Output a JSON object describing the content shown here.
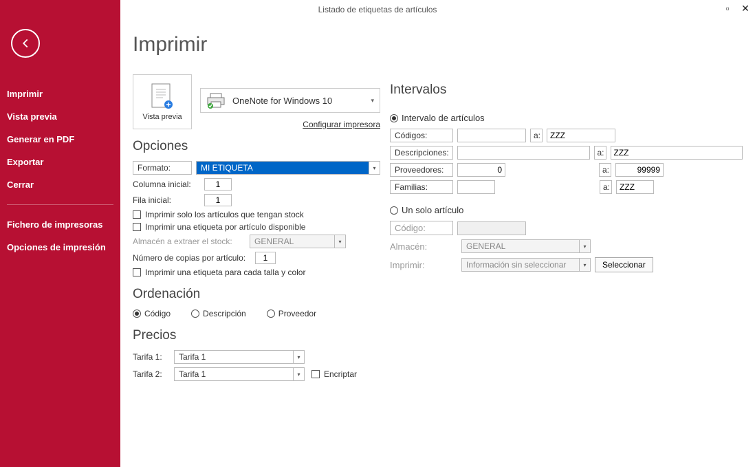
{
  "window": {
    "title": "Listado de etiquetas de artículos"
  },
  "sidebar": {
    "items": [
      "Imprimir",
      "Vista previa",
      "Generar en PDF",
      "Exportar",
      "Cerrar"
    ],
    "items2": [
      "Fichero de impresoras",
      "Opciones de impresión"
    ]
  },
  "page": {
    "title": "Imprimir"
  },
  "printtop": {
    "preview_label": "Vista previa",
    "printer_name": "OneNote for Windows 10",
    "config_link": "Configurar impresora"
  },
  "opciones": {
    "title": "Opciones",
    "formato_lbl": "Formato:",
    "formato_val": "MI ETIQUETA",
    "col_inicial_lbl": "Columna inicial:",
    "col_inicial_val": "1",
    "fila_inicial_lbl": "Fila inicial:",
    "fila_inicial_val": "1",
    "cb_stock": "Imprimir solo los artículos que tengan stock",
    "cb_disponible": "Imprimir una etiqueta por artículo disponible",
    "almacen_lbl": "Almacén a extraer el stock:",
    "almacen_val": "GENERAL",
    "copias_lbl": "Número de copias por artículo:",
    "copias_val": "1",
    "cb_tallacolor": "Imprimir una etiqueta para cada talla y color"
  },
  "orden": {
    "title": "Ordenación",
    "o1": "Código",
    "o2": "Descripción",
    "o3": "Proveedor"
  },
  "precios": {
    "title": "Precios",
    "t1_lbl": "Tarifa 1:",
    "t1_val": "Tarifa 1",
    "t2_lbl": "Tarifa 2:",
    "t2_val": "Tarifa 1",
    "encriptar": "Encriptar"
  },
  "intervalos": {
    "title": "Intervalos",
    "r_articulos": "Intervalo de artículos",
    "codigos_lbl": "Códigos:",
    "codigos_from": "",
    "codigos_to": "ZZZ",
    "desc_lbl": "Descripciones:",
    "desc_from": "",
    "desc_to": "ZZZ",
    "prov_lbl": "Proveedores:",
    "prov_from": "0",
    "prov_to": "99999",
    "fam_lbl": "Familias:",
    "fam_from": "",
    "fam_to": "ZZZ",
    "a_lbl": "a:",
    "r_uno": "Un solo artículo",
    "codigo_lbl": "Código:",
    "almacen2_lbl": "Almacén:",
    "almacen2_val": "GENERAL",
    "imprimir_lbl": "Imprimir:",
    "imprimir_val": "Información sin seleccionar",
    "seleccionar_btn": "Seleccionar"
  }
}
